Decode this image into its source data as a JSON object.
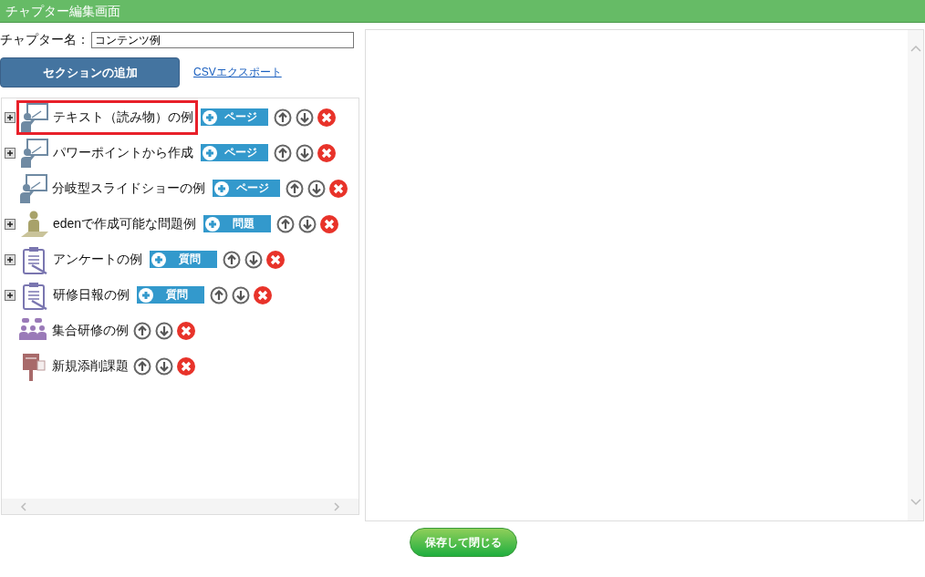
{
  "window": {
    "title": "チャプター編集画面"
  },
  "chapter_name": {
    "label": "チャプター名：",
    "value": "コンテンツ例"
  },
  "add_section_button": "セクションの追加",
  "csv_export_link": "CSVエクスポート",
  "sections": [
    {
      "kind": "slide",
      "label": "テキスト（読み物）の例",
      "expandable": true,
      "highlighted": true,
      "add_button": "ページ"
    },
    {
      "kind": "slide",
      "label": "パワーポイントから作成",
      "expandable": true,
      "highlighted": false,
      "add_button": "ページ"
    },
    {
      "kind": "slide",
      "label": "分岐型スライドショーの例",
      "expandable": false,
      "highlighted": false,
      "add_button": "ページ"
    },
    {
      "kind": "question",
      "label": "edenで作成可能な問題例",
      "expandable": true,
      "highlighted": false,
      "add_button": "問題"
    },
    {
      "kind": "survey",
      "label": "アンケートの例",
      "expandable": true,
      "highlighted": false,
      "add_button": "質問"
    },
    {
      "kind": "survey",
      "label": "研修日報の例",
      "expandable": true,
      "highlighted": false,
      "add_button": "質問"
    },
    {
      "kind": "group",
      "label": "集合研修の例",
      "expandable": false,
      "highlighted": false
    },
    {
      "kind": "post",
      "label": "新規添削課題",
      "expandable": false,
      "highlighted": false
    }
  ],
  "save_button": "保存して閉じる"
}
